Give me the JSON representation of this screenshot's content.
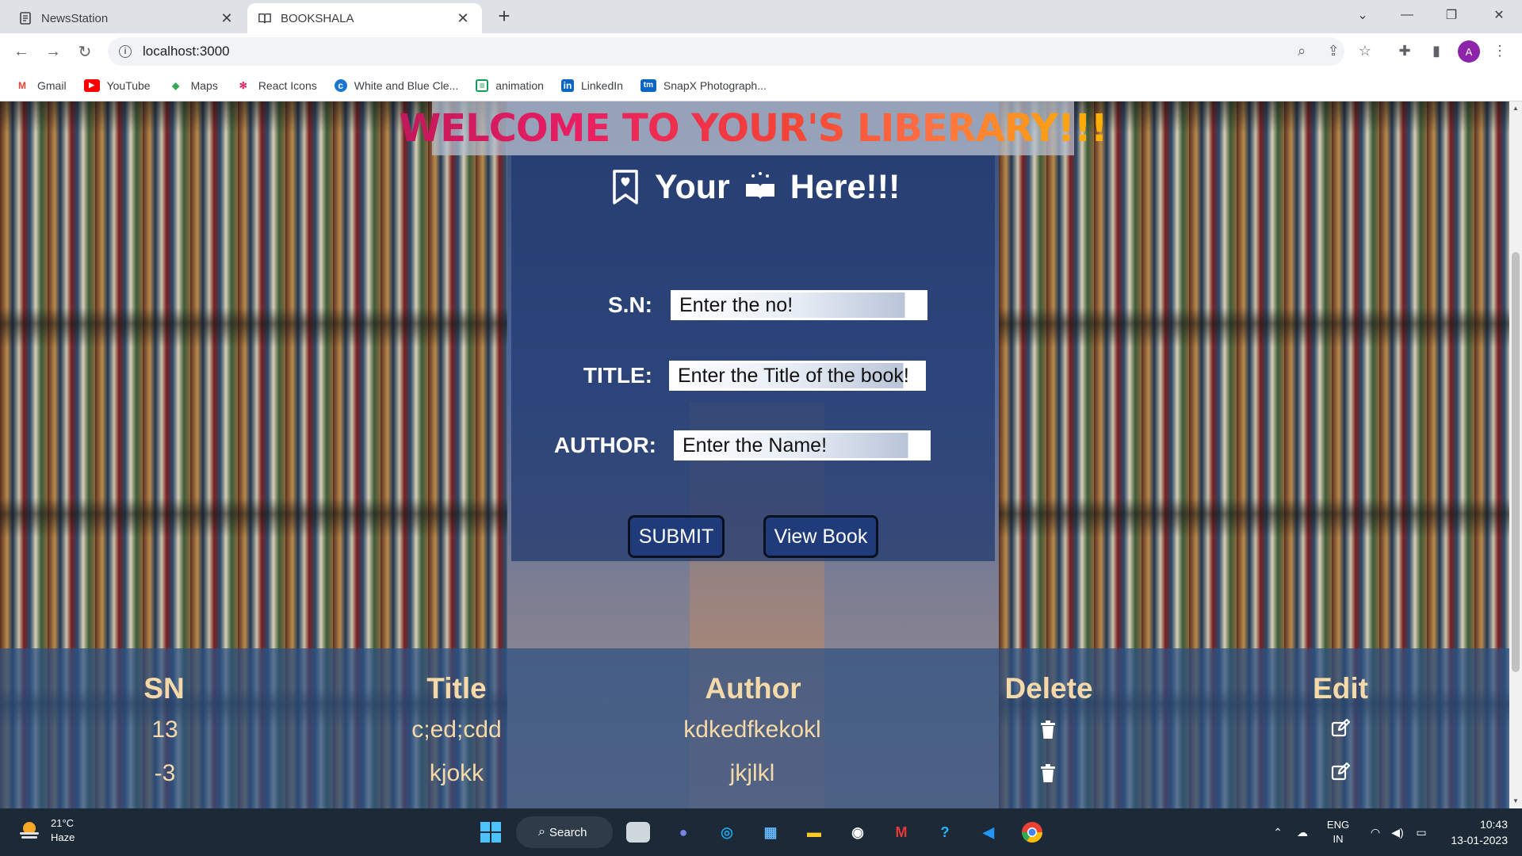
{
  "browser": {
    "tabs": [
      {
        "label": "NewsStation",
        "icon": "document-icon",
        "active": false
      },
      {
        "label": "BOOKSHALA",
        "icon": "book-icon",
        "active": true
      }
    ],
    "url": "localhost:3000",
    "profile_initial": "A",
    "bookmarks": [
      {
        "label": "Gmail",
        "icon": "gmail-icon",
        "color": "#ea4335"
      },
      {
        "label": "YouTube",
        "icon": "youtube-icon",
        "color": "#ff0000"
      },
      {
        "label": "Maps",
        "icon": "maps-icon",
        "color": "#34a853"
      },
      {
        "label": "React Icons",
        "icon": "react-icon",
        "color": "#e91e63"
      },
      {
        "label": "White and Blue Cle...",
        "icon": "canva-icon",
        "color": "#1976d2"
      },
      {
        "label": "animation",
        "icon": "animation-icon",
        "color": "#0f9d58"
      },
      {
        "label": "LinkedIn",
        "icon": "linkedin-icon",
        "color": "#0a66c2"
      },
      {
        "label": "SnapX Photograph...",
        "icon": "snapx-icon",
        "color": "#0a66c2"
      }
    ]
  },
  "page": {
    "welcome": "WELCOME TO YOUR'S LIBERARY!!!",
    "heading": {
      "word1": "Your",
      "word2": "Here!!!"
    },
    "form": {
      "sn_label": "S.N:",
      "sn_placeholder": "Enter the no!",
      "title_label": "TITLE:",
      "title_placeholder": "Enter the Title of the book!",
      "author_label": "AUTHOR:",
      "author_placeholder": "Enter the Name!",
      "submit_label": "SUBMIT",
      "view_label": "View Book"
    },
    "table": {
      "headers": [
        "SN",
        "Title",
        "Author",
        "Delete",
        "Edit"
      ],
      "rows": [
        {
          "sn": "13",
          "title": "c;ed;cdd",
          "author": "kdkedfkekokl"
        },
        {
          "sn": "-3",
          "title": "kjokk",
          "author": "jkjlkl"
        }
      ]
    }
  },
  "taskbar": {
    "temperature": "21°C",
    "condition": "Haze",
    "search_label": "Search",
    "language": "ENG",
    "region": "IN",
    "time": "10:43",
    "date": "13-01-2023"
  },
  "colors": {
    "form_panel": "#1e376e",
    "table_text": "#f6d9a8",
    "button_bg": "#1f3b7a",
    "profile": "#8e24aa"
  }
}
